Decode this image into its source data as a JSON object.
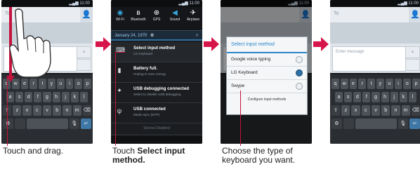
{
  "colors": {
    "arrow": "#d6154a",
    "callout": "#c4133d",
    "accent": "#2b88c8"
  },
  "keyboard": {
    "row1": [
      "q",
      "w",
      "e",
      "r",
      "t",
      "y",
      "u",
      "i",
      "o",
      "p"
    ],
    "row2": [
      "a",
      "s",
      "d",
      "f",
      "g",
      "h",
      "j",
      "k",
      "l"
    ],
    "row3": [
      "z",
      "x",
      "c",
      "v",
      "b",
      "n",
      "m"
    ]
  },
  "screens": {
    "s1": {
      "to_label": "To",
      "caption": "Touch and drag."
    },
    "s2": {
      "quick_settings": [
        {
          "icon": "wifi-icon",
          "label": "Wi-Fi"
        },
        {
          "icon": "bluetooth-icon",
          "label": "Bluetooth"
        },
        {
          "icon": "gps-icon",
          "label": "GPS"
        },
        {
          "icon": "sound-icon",
          "label": "Sound"
        },
        {
          "icon": "airplane-icon",
          "label": "Airplane"
        }
      ],
      "date": "January 24, 1970",
      "notifications": [
        {
          "icon": "keyboard-icon",
          "title": "Select input method",
          "sub": "LG Keyboard"
        },
        {
          "icon": "battery-icon",
          "title": "Battery full.",
          "sub": "Unplug to save energy."
        },
        {
          "icon": "usb-icon",
          "title": "USB debugging connected",
          "sub": "Select to disable USB debugging."
        },
        {
          "icon": "usb-icon",
          "title": "USB connected",
          "sub": "Media sync (MTP)"
        }
      ],
      "footer": "Service Disabled",
      "caption_prefix": "Touch",
      "caption_bold": "Select input method."
    },
    "s3": {
      "dialog_title": "Select input method",
      "options": [
        {
          "label": "Google voice typing",
          "selected": false
        },
        {
          "label": "LG Keyboard",
          "selected": true
        },
        {
          "label": "Swype",
          "selected": false
        }
      ],
      "configure": "Configure input methods",
      "caption": "Choose the type of keyboard you want."
    },
    "s4": {
      "to_label": "To",
      "placeholder": "Enter message"
    }
  }
}
